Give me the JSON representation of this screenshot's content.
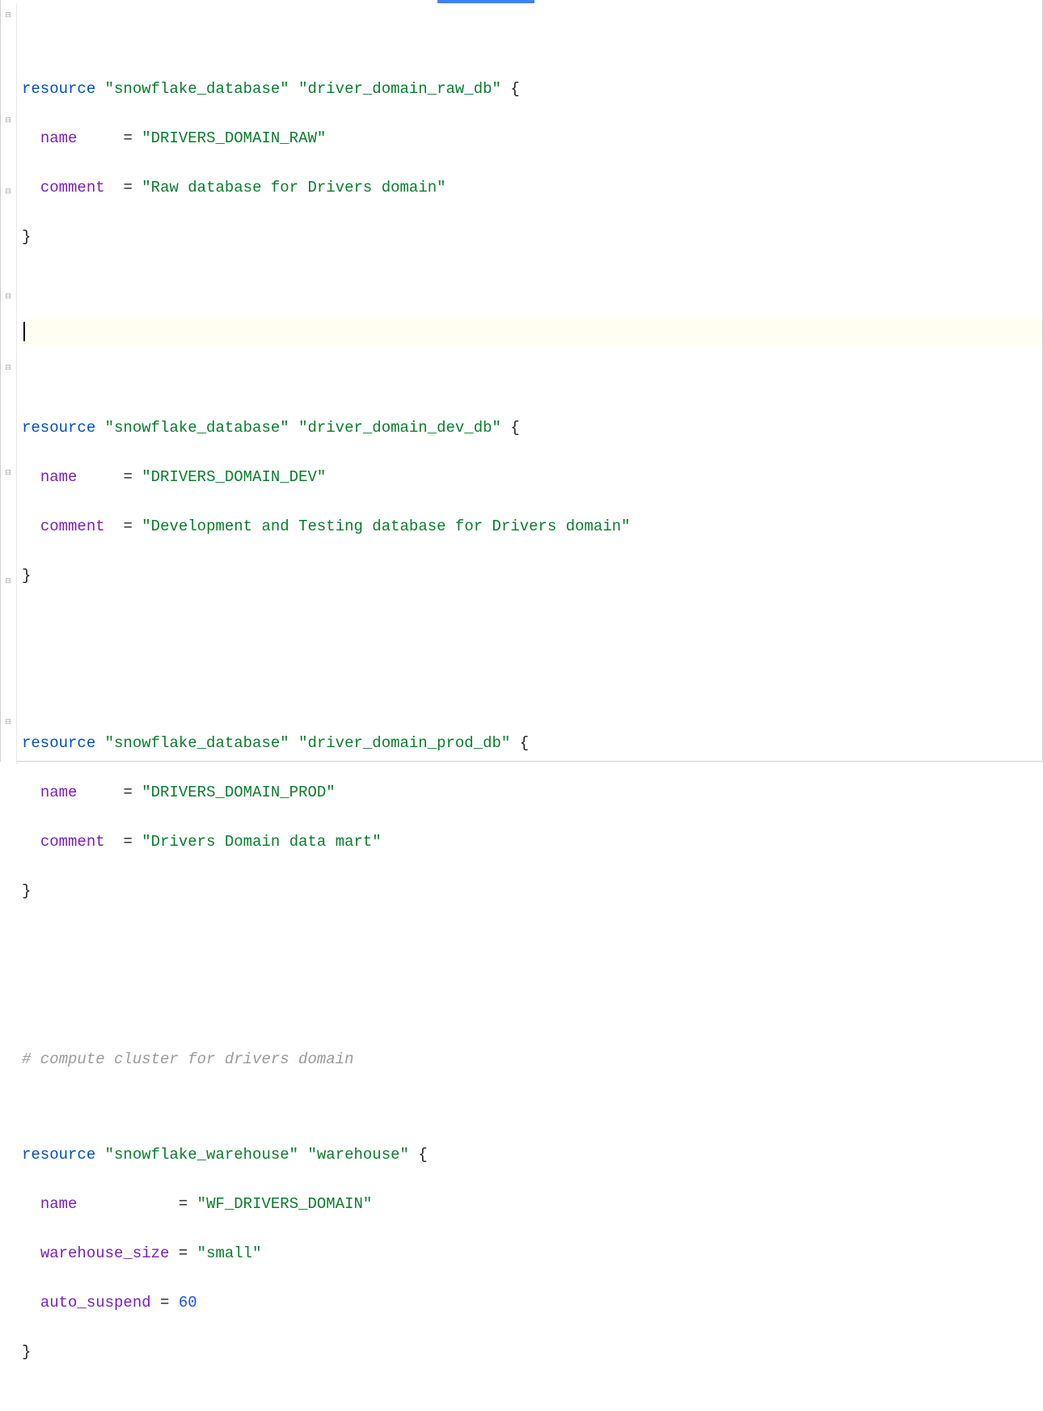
{
  "colors": {
    "keyword": "#004fbf",
    "attribute": "#7a1fbf",
    "string": "#0a7d2d",
    "comment": "#9b9b9b",
    "number": "#1a4fff",
    "highlight_bg": "#fffef0",
    "tab_indicator": "#3b82f6"
  },
  "code": {
    "resources": [
      {
        "keyword": "resource",
        "type": "\"snowflake_database\"",
        "name": "\"driver_domain_raw_db\"",
        "brace_open": "{",
        "attrs": [
          {
            "key": "name",
            "pad": "    ",
            "eq": "=",
            "value": "\"DRIVERS_DOMAIN_RAW\""
          },
          {
            "key": "comment",
            "pad": " ",
            "eq": "=",
            "value": "\"Raw database for Drivers domain\""
          }
        ],
        "brace_close": "}"
      },
      {
        "keyword": "resource",
        "type": "\"snowflake_database\"",
        "name": "\"driver_domain_dev_db\"",
        "brace_open": "{",
        "attrs": [
          {
            "key": "name",
            "pad": "    ",
            "eq": "=",
            "value": "\"DRIVERS_DOMAIN_DEV\""
          },
          {
            "key": "comment",
            "pad": " ",
            "eq": "=",
            "value": "\"Development and Testing database for Drivers domain\""
          }
        ],
        "brace_close": "}"
      },
      {
        "keyword": "resource",
        "type": "\"snowflake_database\"",
        "name": "\"driver_domain_prod_db\"",
        "brace_open": "{",
        "attrs": [
          {
            "key": "name",
            "pad": "    ",
            "eq": "=",
            "value": "\"DRIVERS_DOMAIN_PROD\""
          },
          {
            "key": "comment",
            "pad": " ",
            "eq": "=",
            "value": "\"Drivers Domain data mart\""
          }
        ],
        "brace_close": "}"
      }
    ],
    "comment_line": "# compute cluster for drivers domain",
    "warehouse": {
      "keyword": "resource",
      "type": "\"snowflake_warehouse\"",
      "name": "\"warehouse\"",
      "brace_open": "{",
      "attrs": [
        {
          "key": "name",
          "pad": "          ",
          "eq": "=",
          "value": "\"WF_DRIVERS_DOMAIN\""
        },
        {
          "key": "warehouse_size",
          "pad": "",
          "eq": "=",
          "value": "\"small\""
        },
        {
          "key": "auto_suspend",
          "pad": "",
          "eq": "=",
          "value_num": "60"
        }
      ],
      "brace_close": "}"
    }
  }
}
